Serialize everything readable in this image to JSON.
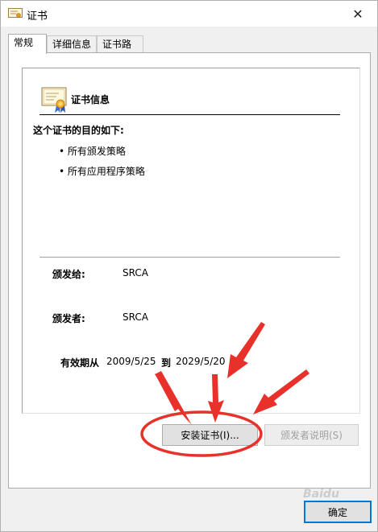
{
  "window": {
    "title": "证书",
    "close_symbol": "✕"
  },
  "tabs": [
    {
      "label": "常规",
      "active": true
    },
    {
      "label": "详细信息",
      "active": false
    },
    {
      "label": "证书路径",
      "active": false
    }
  ],
  "cert": {
    "heading": "证书信息",
    "purpose_title": "这个证书的目的如下:",
    "purposes": [
      "所有颁发策略",
      "所有应用程序策略"
    ],
    "issued_to_label": "颁发给:",
    "issued_to_value": "SRCA",
    "issued_by_label": "颁发者:",
    "issued_by_value": "SRCA",
    "validity_label": "有效期从",
    "valid_from": "2009/5/25",
    "to_label": "到",
    "valid_to": "2029/5/20"
  },
  "buttons": {
    "install": "安装证书(I)...",
    "issuer_statement": "颁发者说明(S)",
    "ok": "确定"
  },
  "annotation": {
    "color": "#e8312a"
  },
  "watermark": "Baidu"
}
